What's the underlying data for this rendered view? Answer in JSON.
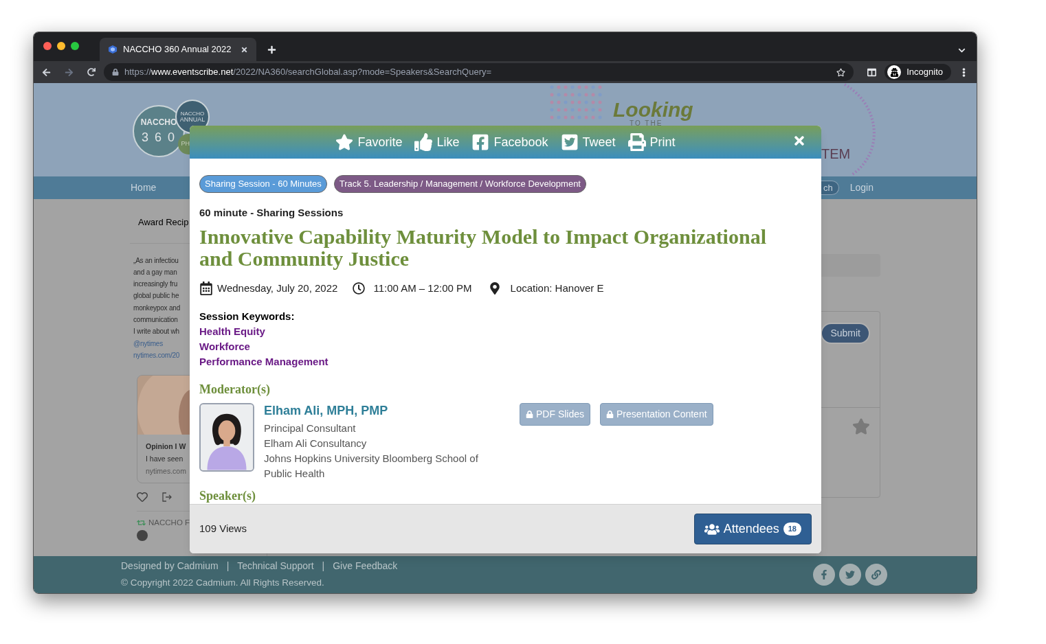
{
  "browser": {
    "tab_title": "NACCHO 360 Annual 2022",
    "url": {
      "scheme": "https://",
      "host": "www.eventscribe.net",
      "path": "/2022/NA360/searchGlobal.asp?mode=Speakers&SearchQuery="
    },
    "profile": "Incognito"
  },
  "background": {
    "logo": {
      "name": "NACCHO",
      "number": "3 6 0",
      "badge_top": "NACCHO",
      "badge_bottom": "ANNUAL",
      "corner": "PH"
    },
    "banner": {
      "headline": "Looking",
      "subline": "TO THE",
      "tail": "TEM"
    },
    "nav": {
      "home": "Home",
      "search": "ch",
      "login": "Login"
    },
    "sidebar": {
      "heading": "Award Recip",
      "tweet_lines": [
        "„As an infectiou",
        "and a gay man",
        "increasingly fru",
        "global public he",
        "monkeypox and",
        "communication",
        "I write about wh"
      ],
      "links": [
        "@nytimes",
        "nytimes.com/20"
      ],
      "card_title": "Opinion I W",
      "card_text": "I have seen",
      "card_source": "nytimes.com",
      "retweet_by": "NACCHO F"
    },
    "submit": "Submit",
    "footer": {
      "separators": [
        "|",
        "|"
      ],
      "links": [
        "Designed by Cadmium",
        "Technical Support",
        "Give Feedback"
      ],
      "copyright": "© Copyright 2022 Cadmium. All Rights Reserved."
    }
  },
  "modal": {
    "actions": [
      {
        "kind": "favorite",
        "label": "Favorite"
      },
      {
        "kind": "like",
        "label": "Like"
      },
      {
        "kind": "facebook",
        "label": "Facebook"
      },
      {
        "kind": "tweet",
        "label": "Tweet"
      },
      {
        "kind": "print",
        "label": "Print"
      }
    ],
    "tags": [
      {
        "label": "Sharing Session - 60 Minutes",
        "color": "#5a9bd8"
      },
      {
        "label": "Track 5. Leadership / Management / Workforce Development",
        "color": "#7d5a86"
      }
    ],
    "session_type": "60 minute - Sharing Sessions",
    "title": "Innovative Capability Maturity Model to Impact Organizational and Community Justice",
    "date": "Wednesday, July 20, 2022",
    "time": "11:00 AM – 12:00 PM",
    "location": "Location: Hanover E",
    "keywords_label": "Session Keywords:",
    "keywords": [
      "Health Equity",
      "Workforce",
      "Performance Management"
    ],
    "moderators_heading": "Moderator(s)",
    "moderator": {
      "name": "Elham Ali, MPH, PMP",
      "lines": [
        "Principal Consultant",
        "Elham Ali Consultancy",
        "Johns Hopkins University Bloomberg School of Public Health"
      ]
    },
    "resources": [
      "PDF Slides",
      "Presentation Content"
    ],
    "speakers_heading": "Speaker(s)",
    "views": "109 Views",
    "attendees": {
      "label": "Attendees",
      "count": "18"
    }
  }
}
